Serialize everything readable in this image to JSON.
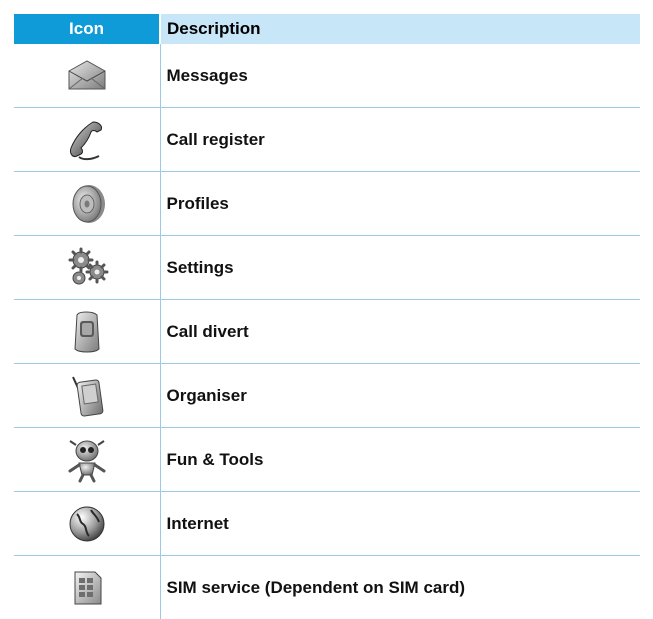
{
  "header": {
    "icon_col": "Icon",
    "desc_col": "Description"
  },
  "rows": [
    {
      "icon": "envelope-icon",
      "label": "Messages"
    },
    {
      "icon": "phone-handset-icon",
      "label": "Call register"
    },
    {
      "icon": "speaker-icon",
      "label": "Profiles"
    },
    {
      "icon": "gears-icon",
      "label": "Settings"
    },
    {
      "icon": "flip-phone-icon",
      "label": "Call divert"
    },
    {
      "icon": "pda-icon",
      "label": "Organiser"
    },
    {
      "icon": "robot-icon",
      "label": "Fun & Tools"
    },
    {
      "icon": "globe-icon",
      "label": "Internet"
    },
    {
      "icon": "sim-card-icon",
      "label": "SIM service (Dependent on SIM card)"
    }
  ],
  "colors": {
    "header_icon_bg": "#0f9ad8",
    "header_desc_bg": "#c7e6f8",
    "row_divider": "#9cc9e6"
  }
}
